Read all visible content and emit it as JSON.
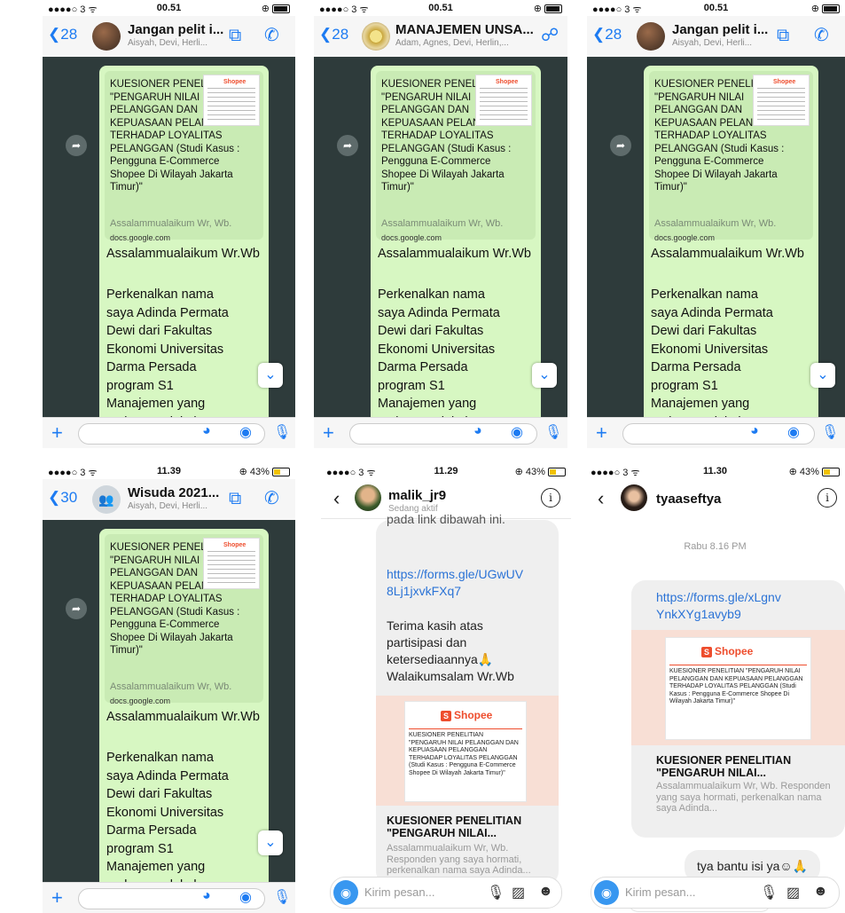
{
  "wa_common": {
    "preview_title": "KUESIONER PENELITIAN \"PENGARUH NILAI PELANGGAN DAN KEPUASAAN PELANGGAN TERHADAP LOYALITAS PELANGGAN (Studi Kasus : Pengguna E-Commerce Shopee Di Wilayah Jakarta Timur)\"",
    "preview_sub": "Assalammualaikum Wr, Wb.",
    "preview_domain": "docs.google.com",
    "greeting": "Assalammualaikum Wr.Wb",
    "intro": "Perkenalkan nama saya Adinda Permata Dewi dari Fakultas Ekonomi Universitas Darma Persada program S1 Manajemen yang sedang melakukan penelitian skripsi.",
    "shopee": "Shopee"
  },
  "p1": {
    "carrier": "●●●●○ 3 ᯤ",
    "time": "00.51",
    "back_count": "28",
    "title": "Jangan pelit i...",
    "members": "Aisyah, Devi, Herli..."
  },
  "p2": {
    "carrier": "●●●●○ 3 ᯤ",
    "time": "00.51",
    "back_count": "28",
    "title": "MANAJEMEN UNSA...",
    "members": "Adam, Agnes, Devi, Herlin,..."
  },
  "p3": {
    "carrier": "●●●●○ 3 ᯤ",
    "time": "00.51",
    "back_count": "28",
    "title": "Jangan pelit i...",
    "members": "Aisyah, Devi, Herli..."
  },
  "p4": {
    "carrier": "●●●●○ 3 ᯤ",
    "time": "11.39",
    "battery": "43%",
    "back_count": "30",
    "title": "Wisuda 2021...",
    "members": "Aisyah, Devi, Herli..."
  },
  "p5": {
    "carrier": "●●●●○ 3 ᯤ",
    "time": "11.29",
    "battery": "43%",
    "username": "malik_jr9",
    "status": "Sedang aktif",
    "top_cut": "pada link dibawah ini.",
    "link": "https://forms.gle/UGwUV8Lj1jxvkFXq7",
    "thanks": "Terima kasih atas partisipasi dan ketersediaannya🙏",
    "closing": "Walaikumsalam Wr.Wb",
    "card_desc": "KUESIONER PENELITIAN \"PENGARUH NILAI PELANGGAN DAN KEPUASAAN PELANGGAN TERHADAP LOYALITAS PELANGGAN (Studi Kasus : Pengguna E-Commerce Shopee Di Wilayah Jakarta Timur)\"",
    "card_title": "KUESIONER PENELITIAN \"PENGARUH NILAI...",
    "card_sub": "Assalammualaikum Wr, Wb. Responden yang saya hormati, perkenalkan nama saya Adinda...",
    "input_placeholder": "Kirim pesan..."
  },
  "p6": {
    "carrier": "●●●●○ 3 ᯤ",
    "time": "11.30",
    "battery": "43%",
    "username": "tyaaseftya",
    "timestamp": "Rabu 8.16 PM",
    "link": "https://forms.gle/xLgnvYnkXYg1avyb9",
    "card_desc": "KUESIONER PENELITIAN \"PENGARUH NILAI PELANGGAN DAN KEPUASAAN PELANGGAN TERHADAP LOYALITAS PELANGGAN (Studi Kasus : Pengguna E-Commerce Shopee Di Wilayah Jakarta Timur)\"",
    "card_title": "KUESIONER PENELITIAN \"PENGARUH NILAI...",
    "card_sub": "Assalammualaikum Wr, Wb. Responden yang saya hormati, perkenalkan nama saya Adinda...",
    "reply": "tya bantu isi ya☺🙏",
    "input_placeholder": "Kirim pesan..."
  },
  "colors": {
    "whatsapp_blue": "#1d7bf2",
    "bubble_green": "#d7f7c2",
    "shopee": "#ee4d2d",
    "instagram_blue": "#3897f0"
  },
  "icons": [
    "back-chevron-icon",
    "video-call-icon",
    "phone-icon",
    "add-participant-icon",
    "forward-icon",
    "chevron-down-icon",
    "plus-icon",
    "sticker-icon",
    "camera-icon",
    "microphone-icon",
    "info-icon",
    "gallery-icon",
    "sticker-face-icon"
  ]
}
